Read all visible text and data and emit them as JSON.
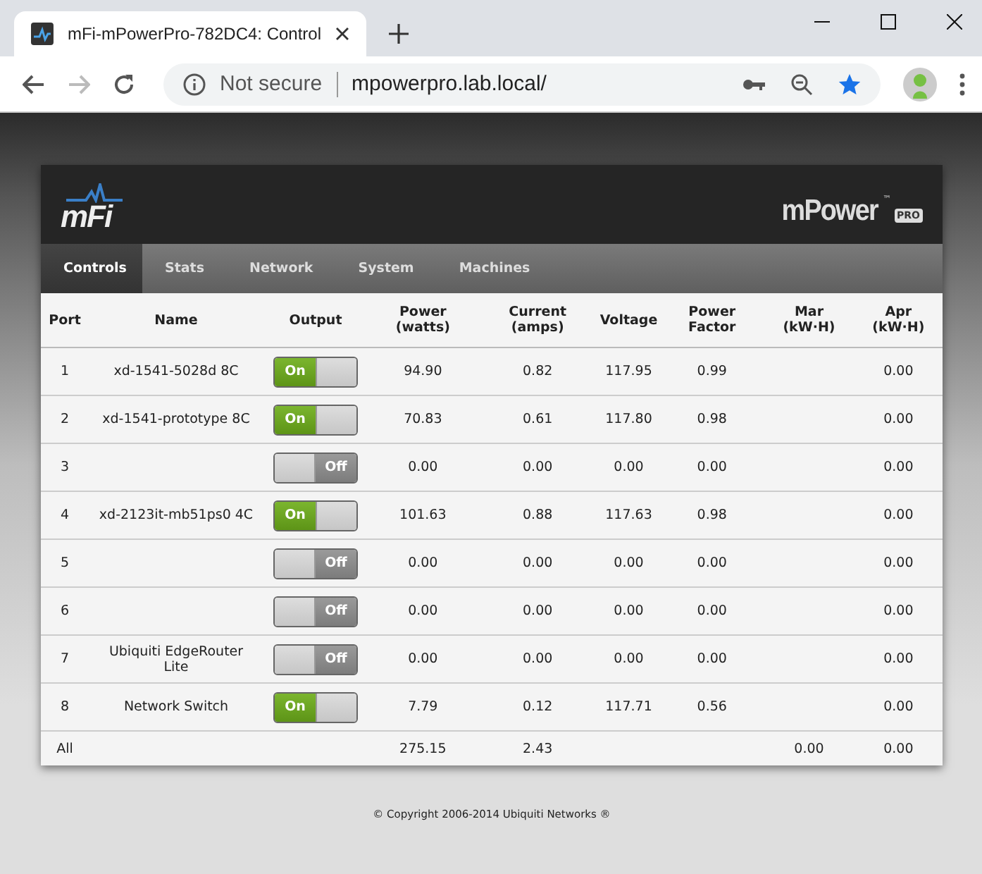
{
  "browser": {
    "tab_title": "mFi-mPowerPro-782DC4: Control",
    "security": "Not secure",
    "url": "mpowerpro.lab.local/"
  },
  "header": {
    "logo": "mFi",
    "product": "mPower",
    "product_badge": "PRO",
    "trademark": "™"
  },
  "tabs": [
    {
      "label": "Controls",
      "selected": true
    },
    {
      "label": "Stats",
      "selected": false
    },
    {
      "label": "Network",
      "selected": false
    },
    {
      "label": "System",
      "selected": false
    },
    {
      "label": "Machines",
      "selected": false
    }
  ],
  "table": {
    "columns": [
      "Port",
      "Name",
      "Output",
      "Power (watts)",
      "Current (amps)",
      "Voltage",
      "Power Factor",
      "Mar (kW·H)",
      "Apr (kW·H)"
    ],
    "rows": [
      {
        "port": "1",
        "name": "xd-1541-5028d 8C",
        "on": true,
        "output_label": "On",
        "power": "94.90",
        "current": "0.82",
        "voltage": "117.95",
        "power_factor": "0.99",
        "apr": "0.00"
      },
      {
        "port": "2",
        "name": "xd-1541-prototype 8C",
        "on": true,
        "output_label": "On",
        "power": "70.83",
        "current": "0.61",
        "voltage": "117.80",
        "power_factor": "0.98",
        "apr": "0.00"
      },
      {
        "port": "3",
        "on": false,
        "output_label": "Off",
        "power": "0.00",
        "current": "0.00",
        "voltage": "0.00",
        "power_factor": "0.00",
        "apr": "0.00"
      },
      {
        "port": "4",
        "name": "xd-2123it-mb51ps0 4C",
        "on": true,
        "output_label": "On",
        "power": "101.63",
        "current": "0.88",
        "voltage": "117.63",
        "power_factor": "0.98",
        "apr": "0.00"
      },
      {
        "port": "5",
        "on": false,
        "output_label": "Off",
        "power": "0.00",
        "current": "0.00",
        "voltage": "0.00",
        "power_factor": "0.00",
        "apr": "0.00"
      },
      {
        "port": "6",
        "on": false,
        "output_label": "Off",
        "power": "0.00",
        "current": "0.00",
        "voltage": "0.00",
        "power_factor": "0.00",
        "apr": "0.00"
      },
      {
        "port": "7",
        "name": "Ubiquiti EdgeRouter Lite",
        "on": false,
        "output_label": "Off",
        "power": "0.00",
        "current": "0.00",
        "voltage": "0.00",
        "power_factor": "0.00",
        "apr": "0.00"
      },
      {
        "port": "8",
        "name": "Network Switch",
        "on": true,
        "output_label": "On",
        "power": "7.79",
        "current": "0.12",
        "voltage": "117.71",
        "power_factor": "0.56",
        "apr": "0.00"
      }
    ],
    "total": {
      "port": "All",
      "power": "275.15",
      "current": "2.43",
      "mar": "0.00",
      "apr": "0.00"
    }
  },
  "footer": "© Copyright 2006-2014 Ubiquiti Networks ®"
}
